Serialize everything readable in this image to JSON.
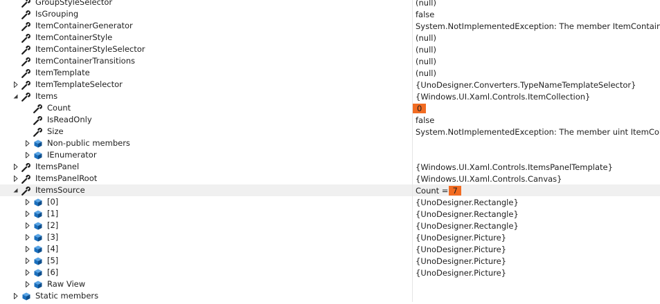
{
  "colors": {
    "highlight": "#f26c22",
    "wrench": "#1e1e1e",
    "cube": "#1a6fbd"
  },
  "rows": [
    {
      "name": "GroupStyleSelector",
      "value": "(null)",
      "icon": "wrench-icon",
      "expander": "none",
      "level": 0
    },
    {
      "name": "IsGrouping",
      "value": "false",
      "icon": "wrench-icon",
      "expander": "none",
      "level": 0
    },
    {
      "name": "ItemContainerGenerator",
      "value": "System.NotImplementedException: The member ItemContainerGen",
      "icon": "wrench-icon",
      "expander": "none",
      "level": 0
    },
    {
      "name": "ItemContainerStyle",
      "value": "(null)",
      "icon": "wrench-icon",
      "expander": "none",
      "level": 0
    },
    {
      "name": "ItemContainerStyleSelector",
      "value": "(null)",
      "icon": "wrench-icon",
      "expander": "none",
      "level": 0
    },
    {
      "name": "ItemContainerTransitions",
      "value": "(null)",
      "icon": "wrench-icon",
      "expander": "none",
      "level": 0
    },
    {
      "name": "ItemTemplate",
      "value": "(null)",
      "icon": "wrench-icon",
      "expander": "none",
      "level": 0
    },
    {
      "name": "ItemTemplateSelector",
      "value": "{UnoDesigner.Converters.TypeNameTemplateSelector}",
      "icon": "wrench-icon",
      "expander": "collapsed",
      "level": 0
    },
    {
      "name": "Items",
      "value": "{Windows.UI.Xaml.Controls.ItemCollection}",
      "icon": "wrench-icon",
      "expander": "expanded",
      "level": 0
    },
    {
      "name": "Count",
      "value": "0",
      "valueHighlight": true,
      "icon": "wrench-icon",
      "expander": "none",
      "level": 1
    },
    {
      "name": "IsReadOnly",
      "value": "false",
      "icon": "wrench-icon",
      "expander": "none",
      "level": 1
    },
    {
      "name": "Size",
      "value": "System.NotImplementedException: The member uint ItemCollectio",
      "icon": "wrench-icon",
      "expander": "none",
      "level": 1
    },
    {
      "name": "Non-public members",
      "value": "",
      "icon": "cube-icon",
      "expander": "collapsed",
      "level": 1
    },
    {
      "name": "IEnumerator",
      "value": "",
      "icon": "cube-icon",
      "expander": "collapsed",
      "level": 1
    },
    {
      "name": "ItemsPanel",
      "value": "{Windows.UI.Xaml.Controls.ItemsPanelTemplate}",
      "icon": "wrench-icon",
      "expander": "collapsed",
      "level": 0
    },
    {
      "name": "ItemsPanelRoot",
      "value": "{Windows.UI.Xaml.Controls.Canvas}",
      "icon": "wrench-icon",
      "expander": "collapsed",
      "level": 0
    },
    {
      "name": "ItemsSource",
      "valuePrefix": "Count = ",
      "value": "7",
      "valueHighlight": true,
      "icon": "wrench-icon",
      "expander": "expanded",
      "level": 0,
      "selected": true
    },
    {
      "name": "[0]",
      "value": "{UnoDesigner.Rectangle}",
      "icon": "cube-icon",
      "expander": "collapsed",
      "level": 1
    },
    {
      "name": "[1]",
      "value": "{UnoDesigner.Rectangle}",
      "icon": "cube-icon",
      "expander": "collapsed",
      "level": 1
    },
    {
      "name": "[2]",
      "value": "{UnoDesigner.Rectangle}",
      "icon": "cube-icon",
      "expander": "collapsed",
      "level": 1
    },
    {
      "name": "[3]",
      "value": "{UnoDesigner.Picture}",
      "icon": "cube-icon",
      "expander": "collapsed",
      "level": 1
    },
    {
      "name": "[4]",
      "value": "{UnoDesigner.Picture}",
      "icon": "cube-icon",
      "expander": "collapsed",
      "level": 1
    },
    {
      "name": "[5]",
      "value": "{UnoDesigner.Picture}",
      "icon": "cube-icon",
      "expander": "collapsed",
      "level": 1
    },
    {
      "name": "[6]",
      "value": "{UnoDesigner.Picture}",
      "icon": "cube-icon",
      "expander": "collapsed",
      "level": 1
    },
    {
      "name": "Raw View",
      "value": "",
      "icon": "cube-icon",
      "expander": "collapsed",
      "level": 1
    },
    {
      "name": "Static members",
      "value": "",
      "icon": "cube-icon",
      "expander": "collapsed",
      "level": 0
    }
  ]
}
